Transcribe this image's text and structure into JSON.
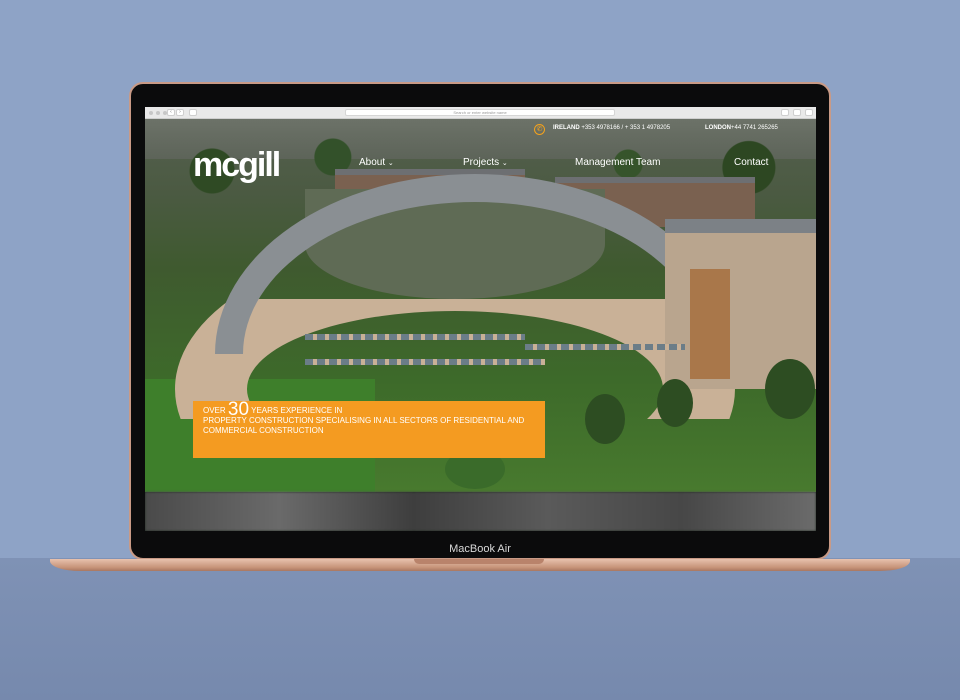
{
  "browser": {
    "url_placeholder": "Search or enter website name"
  },
  "header": {
    "logo": "mcgill",
    "contact": {
      "ireland_label": "IRELAND",
      "ireland_phones": "+353 4978166 / + 353 1 4978205",
      "london_label": "LONDON",
      "london_phone": "+44 7741 265265"
    },
    "nav": [
      {
        "label": "About",
        "has_dropdown": true
      },
      {
        "label": "Projects",
        "has_dropdown": true
      },
      {
        "label": "Management Team",
        "has_dropdown": false
      },
      {
        "label": "Contact",
        "has_dropdown": false
      }
    ],
    "chevron": "⌄"
  },
  "promo": {
    "over": "OVER",
    "number": "30",
    "years": "YEARS",
    "rest_line1": "EXPERIENCE IN",
    "line2": "PROPERTY CONSTRUCTION SPECIALISING IN ALL SECTORS OF RESIDENTIAL AND",
    "line3": "COMMERCIAL CONSTRUCTION"
  },
  "device": {
    "model": "MacBook Air"
  },
  "colors": {
    "accent": "#f49b21",
    "background": "#8ea3c6",
    "laptop_gold": "#c99a86"
  }
}
